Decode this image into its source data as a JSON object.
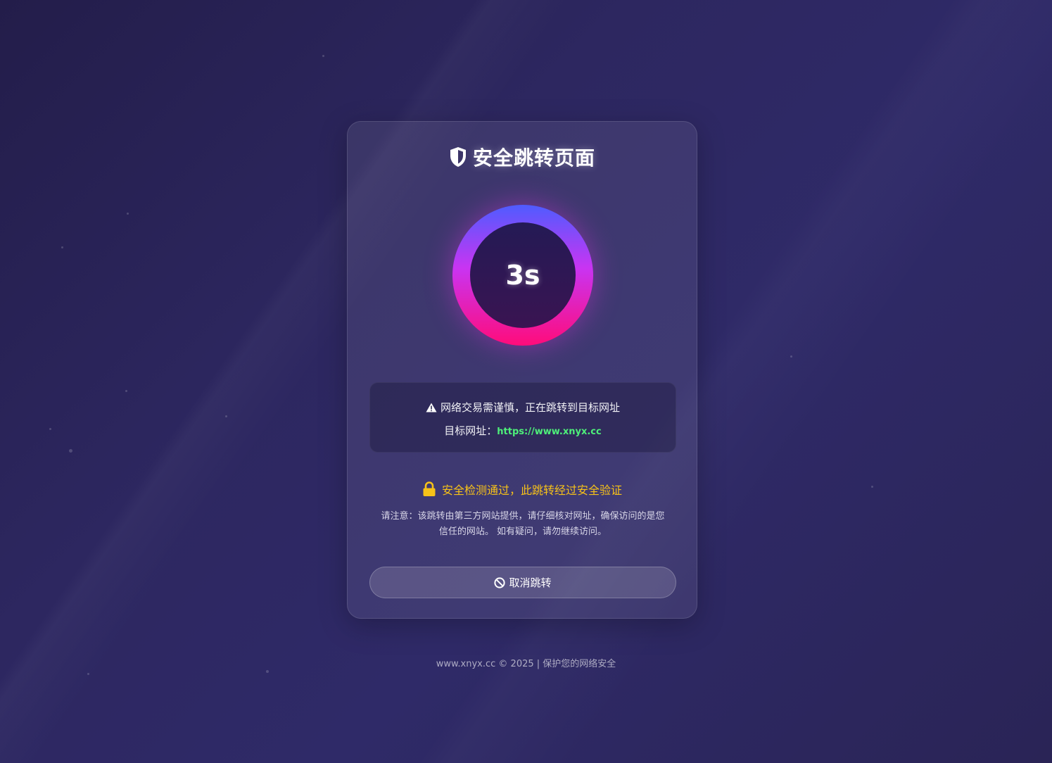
{
  "header": {
    "title": "安全跳转页面",
    "icon": "shield-icon"
  },
  "countdown": {
    "text": "3s",
    "colors": [
      "#4f5cff",
      "#c934f2",
      "#ff0c7a"
    ]
  },
  "info": {
    "warning": "网络交易需谨慎，正在跳转到目标网址",
    "target_label": "目标网址：",
    "target_url": "https://www.xnyx.cc"
  },
  "security": {
    "message": "安全检测通过，此跳转经过安全验证",
    "icon": "lock-icon",
    "color": "#f7c218"
  },
  "notice": {
    "line1": "请注意：该跳转由第三方网站提供，请仔细核对网址，确保访问的是您",
    "line2": "信任的网站。 如有疑问，请勿继续访问。"
  },
  "actions": {
    "cancel_label": "取消跳转",
    "cancel_icon": "ban-icon"
  },
  "footer": {
    "text": "www.xnyx.cc © 2025 | 保护您的网络安全"
  }
}
